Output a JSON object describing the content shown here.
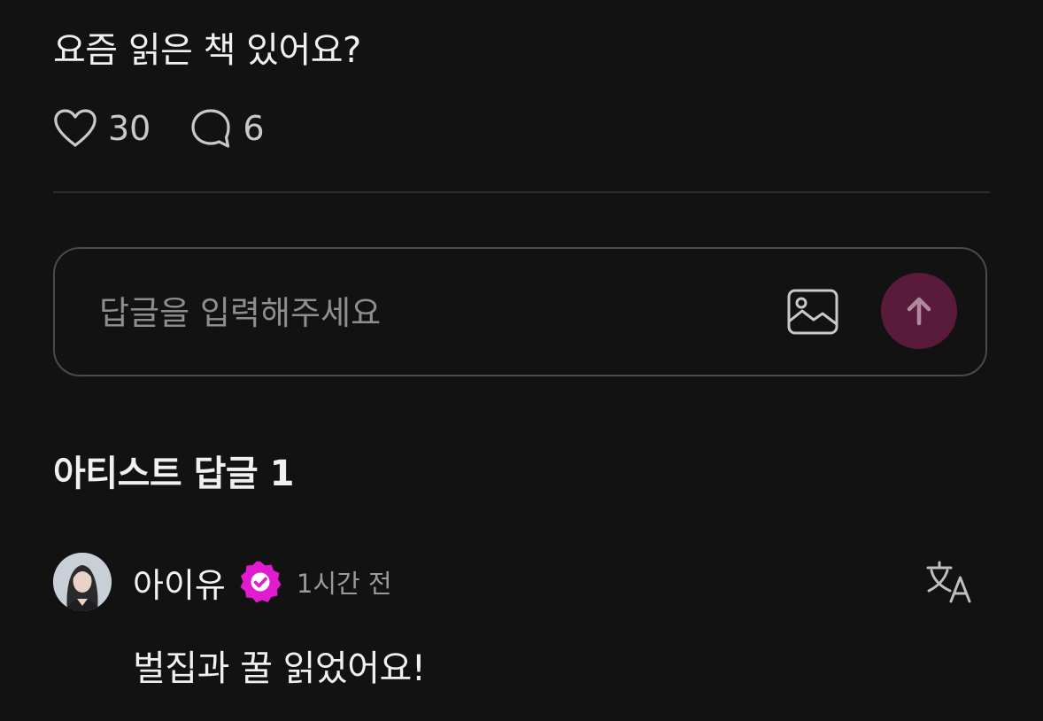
{
  "post": {
    "text": "요즘 읽은 책 있어요?",
    "likes": "30",
    "comments": "6"
  },
  "reply": {
    "placeholder": "답글을 입력해주세요"
  },
  "artist_replies": {
    "title": "아티스트 답글 1",
    "items": [
      {
        "author": "아이유",
        "time": "1시간 전",
        "text": "벌집과 꿀 읽었어요!"
      }
    ]
  },
  "icons": {
    "like": "heart-icon",
    "comment": "speech-bubble-icon",
    "image": "image-icon",
    "send": "arrow-up-icon",
    "verified": "verified-badge-icon",
    "translate": "translate-icon"
  },
  "colors": {
    "background": "#121213",
    "send_button": "#5a1a3b",
    "verified_badge": "#e21bd0"
  }
}
